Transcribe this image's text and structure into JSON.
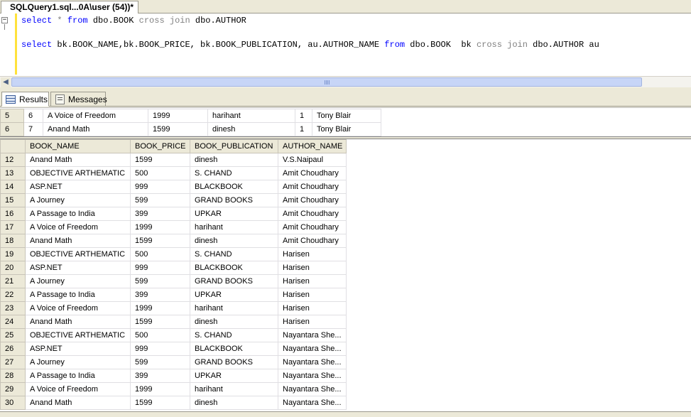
{
  "tab": {
    "title": "SQLQuery1.sql...0A\\user (54))*"
  },
  "editor": {
    "line1": {
      "k1": "select",
      "g1": " * ",
      "k2": "from",
      "t1": " dbo.BOOK ",
      "g2": "cross join",
      "t2": " dbo.AUTHOR"
    },
    "line3": {
      "k1": "select",
      "t1": " bk.BOOK_NAME,bk.BOOK_PRICE, bk.BOOK_PUBLICATION, au.AUTHOR_NAME ",
      "k2": "from",
      "t2": " dbo.BOOK  bk ",
      "g1": "cross join",
      "t3": " dbo.AUTHOR au"
    }
  },
  "result_tabs": {
    "results": "Results",
    "messages": "Messages"
  },
  "grid1": {
    "rows": [
      [
        "5",
        "6",
        "A Voice of Freedom",
        "1999",
        "harihant",
        "1",
        "Tony Blair"
      ],
      [
        "6",
        "7",
        "Anand Math",
        "1599",
        "dinesh",
        "1",
        "Tony Blair"
      ]
    ]
  },
  "grid2": {
    "columns": [
      "BOOK_NAME",
      "BOOK_PRICE",
      "BOOK_PUBLICATION",
      "AUTHOR_NAME"
    ],
    "rows": [
      [
        "12",
        "Anand Math",
        "1599",
        "dinesh",
        "V.S.Naipaul"
      ],
      [
        "13",
        "OBJECTIVE ARTHEMATIC",
        "500",
        "S. CHAND",
        "Amit Choudhary"
      ],
      [
        "14",
        "ASP.NET",
        "999",
        "BLACKBOOK",
        "Amit Choudhary"
      ],
      [
        "15",
        "A Journey",
        "599",
        "GRAND BOOKS",
        "Amit Choudhary"
      ],
      [
        "16",
        "A Passage to India",
        "399",
        "UPKAR",
        "Amit Choudhary"
      ],
      [
        "17",
        "A Voice of Freedom",
        "1999",
        "harihant",
        "Amit Choudhary"
      ],
      [
        "18",
        "Anand Math",
        "1599",
        "dinesh",
        "Amit Choudhary"
      ],
      [
        "19",
        "OBJECTIVE ARTHEMATIC",
        "500",
        "S. CHAND",
        "Harisen"
      ],
      [
        "20",
        "ASP.NET",
        "999",
        "BLACKBOOK",
        "Harisen"
      ],
      [
        "21",
        "A Journey",
        "599",
        "GRAND BOOKS",
        "Harisen"
      ],
      [
        "22",
        "A Passage to India",
        "399",
        "UPKAR",
        "Harisen"
      ],
      [
        "23",
        "A Voice of Freedom",
        "1999",
        "harihant",
        "Harisen"
      ],
      [
        "24",
        "Anand Math",
        "1599",
        "dinesh",
        "Harisen"
      ],
      [
        "25",
        "OBJECTIVE ARTHEMATIC",
        "500",
        "S. CHAND",
        "Nayantara She..."
      ],
      [
        "26",
        "ASP.NET",
        "999",
        "BLACKBOOK",
        "Nayantara She..."
      ],
      [
        "27",
        "A Journey",
        "599",
        "GRAND BOOKS",
        "Nayantara She..."
      ],
      [
        "28",
        "A Passage to India",
        "399",
        "UPKAR",
        "Nayantara She..."
      ],
      [
        "29",
        "A Voice of Freedom",
        "1999",
        "harihant",
        "Nayantara She..."
      ],
      [
        "30",
        "Anand Math",
        "1599",
        "dinesh",
        "Nayantara She..."
      ]
    ]
  }
}
